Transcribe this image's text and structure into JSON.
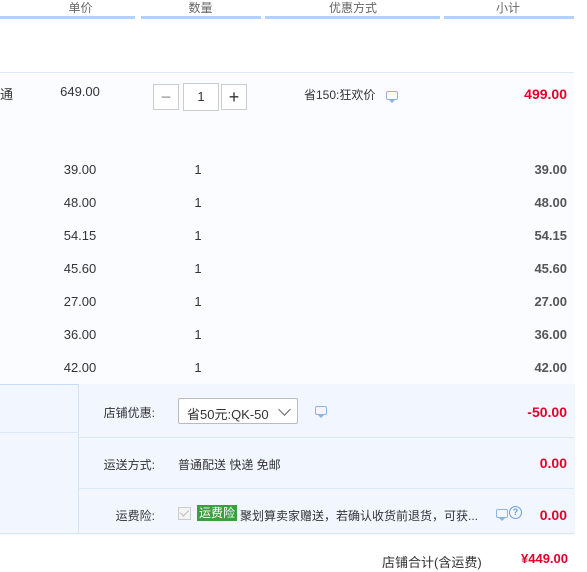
{
  "header": {
    "columns": [
      "单价",
      "数量",
      "优惠方式",
      "小计"
    ]
  },
  "main_item": {
    "name_fragment": "通",
    "price": "649.00",
    "quantity": "1",
    "minus_label": "−",
    "plus_label": "+",
    "discount": "省150:狂欢价",
    "subtotal": "499.00"
  },
  "gift_rows": [
    {
      "price": "39.00",
      "quantity": "1",
      "subtotal": "39.00"
    },
    {
      "price": "48.00",
      "quantity": "1",
      "subtotal": "48.00"
    },
    {
      "price": "54.15",
      "quantity": "1",
      "subtotal": "54.15"
    },
    {
      "price": "45.60",
      "quantity": "1",
      "subtotal": "45.60"
    },
    {
      "price": "27.00",
      "quantity": "1",
      "subtotal": "27.00"
    },
    {
      "price": "36.00",
      "quantity": "1",
      "subtotal": "36.00"
    },
    {
      "price": "42.00",
      "quantity": "1",
      "subtotal": "42.00"
    }
  ],
  "shop_discount": {
    "label": "店铺优惠:",
    "selected": "省50元:QK-50",
    "amount": "-50.00"
  },
  "shipping": {
    "label": "运送方式:",
    "value": "普通配送 快递 免邮",
    "amount": "0.00"
  },
  "insurance": {
    "label": "运费险:",
    "badge": "运费险",
    "text": "聚划算卖家赠送，若确认收货前退货，可获...",
    "help": "?",
    "amount": "0.00"
  },
  "total": {
    "label": "店铺合计(含运费)",
    "value": "¥449.00"
  },
  "colors": {
    "accent_red": "#e4002b",
    "badge_green": "#3a9f3f",
    "header_line": "#b2d1ff"
  },
  "icons": [
    "chat-icon",
    "chevron-down-icon",
    "help-icon",
    "check-icon"
  ]
}
